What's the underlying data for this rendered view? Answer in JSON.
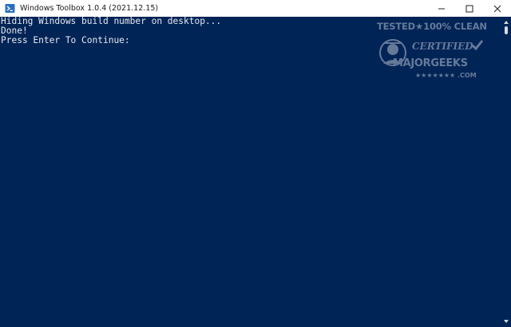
{
  "window": {
    "title": "Windows Toolbox 1.0.4 (2021.12.15)",
    "icon": "powershell-icon",
    "controls": [
      "minimize-icon",
      "maximize-icon",
      "close-icon"
    ]
  },
  "console": {
    "lines": [
      "Hiding Windows build number on desktop...",
      "Done!",
      "Press Enter To Continue:"
    ]
  },
  "watermark": {
    "top_text": "TESTED★100% CLEAN",
    "middle_text": "CERTIFIED",
    "brand_text": "MAJORGEEKS",
    "bottom_text": "★★★★★★★ .COM"
  },
  "colors": {
    "console_background": "#012456",
    "console_text": "#e6e9f0",
    "titlebar_background": "#ffffff"
  }
}
